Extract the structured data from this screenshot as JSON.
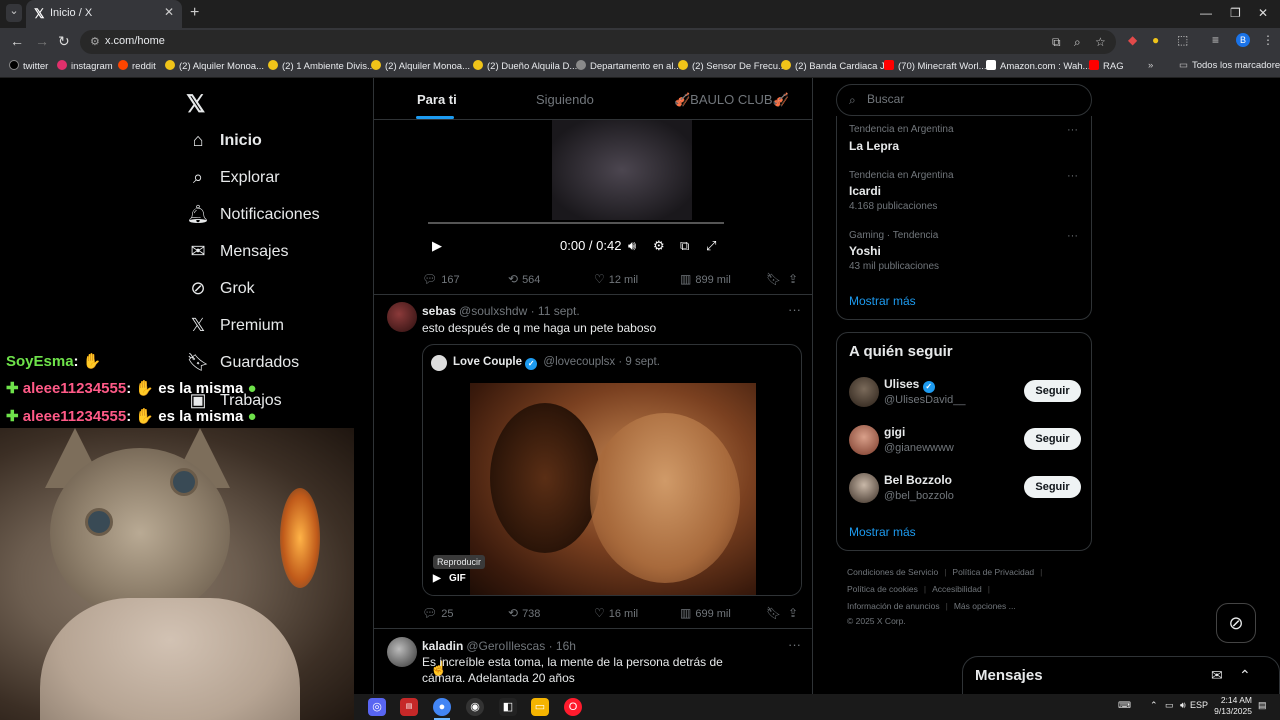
{
  "browser": {
    "tab_title": "Inicio / X",
    "url": "x.com/home",
    "bookmarks": [
      {
        "label": "twitter",
        "color": "#000000"
      },
      {
        "label": "instagram",
        "color": "#e1306c"
      },
      {
        "label": "reddit",
        "color": "#ff4500"
      },
      {
        "label": "(2) Alquiler Monoa...",
        "color": "#f0c419"
      },
      {
        "label": "(2) 1 Ambiente Divis...",
        "color": "#f0c419"
      },
      {
        "label": "(2) Alquiler Monoa...",
        "color": "#f0c419"
      },
      {
        "label": "(2) Dueño Alquila D...",
        "color": "#f0c419"
      },
      {
        "label": "Departamento en al...",
        "color": "#8a8a8a"
      },
      {
        "label": "(2) Sensor De Frecu...",
        "color": "#f0c419"
      },
      {
        "label": "(2) Banda Cardiaca J...",
        "color": "#f0c419"
      },
      {
        "label": "(70) Minecraft Worl...",
        "color": "#ff0000"
      },
      {
        "label": "Amazon.com : Wah...",
        "color": "#ffffff"
      },
      {
        "label": "RAG",
        "color": "#ff0000"
      }
    ],
    "all_bookmarks": "Todos los marcadores"
  },
  "nav": {
    "items": [
      {
        "label": "Inicio",
        "icon": "home-icon"
      },
      {
        "label": "Explorar",
        "icon": "search-icon"
      },
      {
        "label": "Notificaciones",
        "icon": "bell-icon"
      },
      {
        "label": "Mensajes",
        "icon": "mail-icon"
      },
      {
        "label": "Grok",
        "icon": "grok-icon"
      },
      {
        "label": "Premium",
        "icon": "x-icon"
      },
      {
        "label": "Guardados",
        "icon": "bookmark-icon"
      },
      {
        "label": "Trabajos",
        "icon": "briefcase-icon"
      }
    ]
  },
  "overlay": {
    "chat": [
      {
        "user": "SoyEsma",
        "sep": ":",
        "msg": ""
      },
      {
        "user": "aleee11234555",
        "sep": ":",
        "msg": "es la misma"
      },
      {
        "user": "aleee11234555",
        "sep": ":",
        "msg": "es la misma"
      }
    ]
  },
  "feed": {
    "tabs": [
      "Para ti",
      "Siguiendo",
      "🎻BAULO CLUB🎻"
    ],
    "video": {
      "time": "0:00 / 0:42"
    },
    "tweet1_actions": {
      "replies": "167",
      "reposts": "564",
      "likes": "12 mil",
      "views": "899 mil"
    },
    "tweet2": {
      "name": "sebas",
      "handle": "@soulxshdw · 11 sept.",
      "text": "esto después de q me haga un pete baboso",
      "quote": {
        "name": "Love Couple",
        "handle": "@lovecouplsx · 9 sept."
      },
      "tooltip": "Reproducir",
      "gif": "GIF",
      "actions": {
        "replies": "25",
        "reposts": "738",
        "likes": "16 mil",
        "views": "699 mil"
      }
    },
    "tweet3": {
      "name": "kaladin",
      "handle": "@GeroIllescas · 16h",
      "text": "Es increíble esta toma, la mente de la persona detrás de cámara. Adelantada 20 años"
    }
  },
  "sidebar": {
    "search_placeholder": "Buscar",
    "trends": [
      {
        "context": "Tendencia en Argentina",
        "name": "La Lepra",
        "count": ""
      },
      {
        "context": "Tendencia en Argentina",
        "name": "Icardi",
        "count": "4.168 publicaciones"
      },
      {
        "context": "Gaming · Tendencia",
        "name": "Yoshi",
        "count": "43 mil publicaciones"
      }
    ],
    "show_more": "Mostrar más",
    "who_to_follow": "A quién seguir",
    "follows": [
      {
        "name": "Ulises",
        "handle": "@UlisesDavid__",
        "button": "Seguir"
      },
      {
        "name": "gigi",
        "handle": "@gianewwww",
        "button": "Seguir"
      },
      {
        "name": "Bel Bozzolo",
        "handle": "@bel_bozzolo",
        "button": "Seguir"
      }
    ],
    "show_more_2": "Mostrar más",
    "footer": {
      "l1a": "Condiciones de Servicio",
      "l1b": "Política de Privacidad",
      "l2a": "Política de cookies",
      "l2b": "Accesibilidad",
      "l3a": "Información de anuncios",
      "l3b": "Más opciones ...",
      "copyright": "© 2025 X Corp."
    },
    "messages": "Mensajes"
  },
  "taskbar": {
    "lang": "ESP",
    "time": "2:14 AM",
    "date": "9/13/2025"
  }
}
